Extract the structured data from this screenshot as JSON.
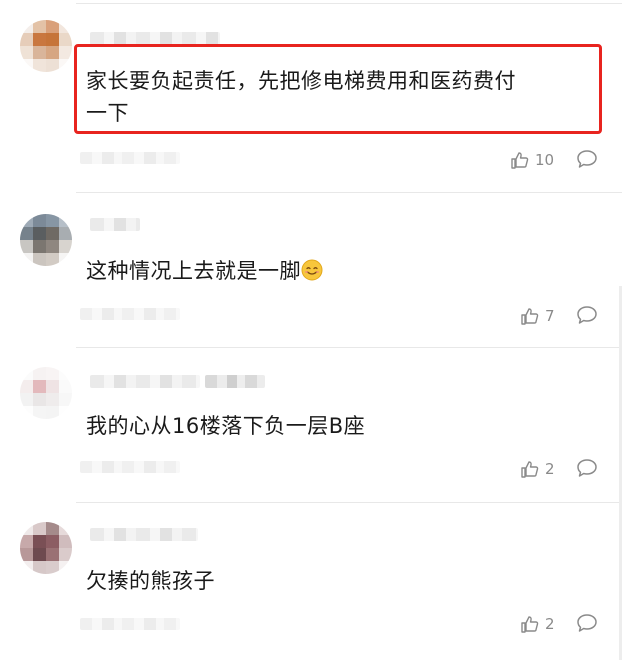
{
  "comments": [
    {
      "text_line1": "家长要负起责任，先把修电梯费用和医药费付",
      "text_line2": "一下",
      "likes": "10"
    },
    {
      "text": "这种情况上去就是一脚",
      "emoji": "smile-emoji",
      "likes": "7"
    },
    {
      "text": "我的心从16楼落下负一层B座",
      "likes": "2"
    },
    {
      "text": "欠揍的熊孩子",
      "likes": "2"
    }
  ],
  "colors": {
    "highlight_border": "#e8241f",
    "meta_text": "#8a8a8a"
  },
  "icons": {
    "like": "thumbs-up-icon",
    "reply": "comment-bubble-icon"
  }
}
